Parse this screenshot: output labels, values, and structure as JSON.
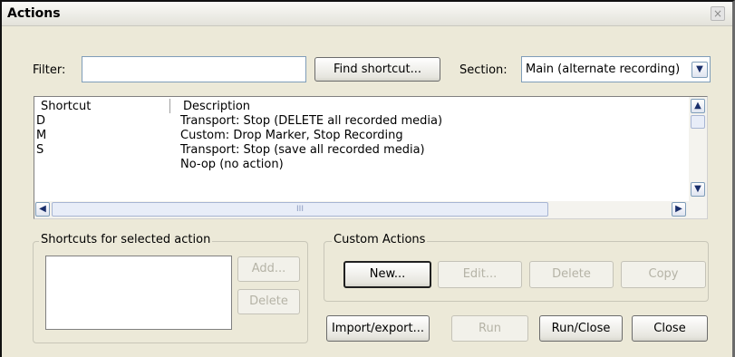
{
  "window": {
    "title": "Actions",
    "close_glyph": "×"
  },
  "filter": {
    "label": "Filter:",
    "value": "",
    "find_button": "Find shortcut..."
  },
  "section": {
    "label": "Section:",
    "selected": "Main (alternate recording)"
  },
  "list": {
    "columns": [
      "Shortcut",
      "Description"
    ],
    "rows": [
      {
        "shortcut": "D",
        "description": "Transport: Stop (DELETE all recorded media)"
      },
      {
        "shortcut": "M",
        "description": "Custom: Drop Marker, Stop Recording"
      },
      {
        "shortcut": "S",
        "description": "Transport: Stop (save all recorded media)"
      },
      {
        "shortcut": "",
        "description": "No-op (no action)"
      }
    ],
    "hscroll_grip": "III"
  },
  "shortcuts_group": {
    "label": "Shortcuts for selected action",
    "add_button": "Add...",
    "delete_button": "Delete"
  },
  "custom_group": {
    "label": "Custom Actions",
    "new_button": "New...",
    "edit_button": "Edit...",
    "delete_button": "Delete",
    "copy_button": "Copy"
  },
  "bottom": {
    "import_export_button": "Import/export...",
    "run_button": "Run",
    "run_close_button": "Run/Close",
    "close_button": "Close"
  }
}
